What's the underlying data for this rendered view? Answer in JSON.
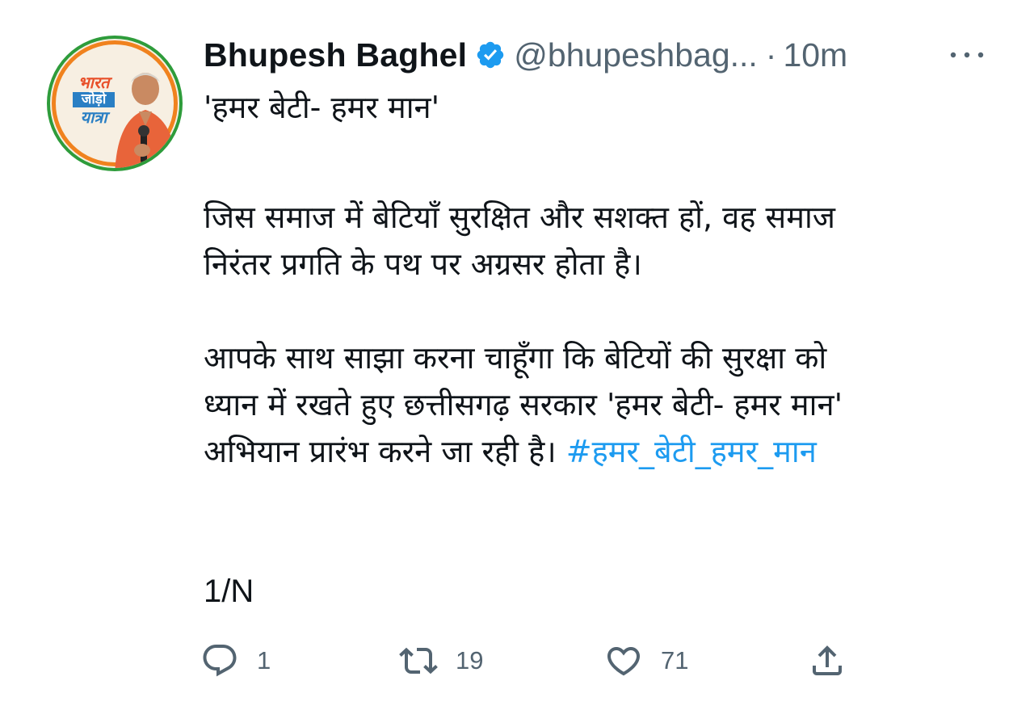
{
  "author": {
    "display_name": "Bhupesh Baghel",
    "handle": "@bhupeshbag...",
    "separator": "·",
    "timestamp": "10m",
    "verified": true,
    "avatar_logo": [
      "भारत",
      "जोड़ो",
      "यात्रा"
    ]
  },
  "tweet": {
    "title_line": "'हमर बेटी- हमर मान'",
    "paragraph1": [
      "जिस समाज में बेटियाँ सुरक्षित और सशक्त हों, वह समाज",
      "निरंतर प्रगति के पथ पर अग्रसर होता है।"
    ],
    "paragraph2": [
      "आपके साथ साझा करना चाहूँगा कि बेटियों की सुरक्षा को",
      "ध्यान में रखते हुए छत्तीसगढ़ सरकार 'हमर बेटी- हमर मान'"
    ],
    "paragraph2_last_text": "अभियान प्रारंभ करने जा रही है। ",
    "hashtag": "#हमर_बेटी_हमर_मान",
    "thread_marker": "1/N"
  },
  "actions": {
    "reply_count": "1",
    "retweet_count": "19",
    "like_count": "71"
  },
  "colors": {
    "text": "#0f1419",
    "secondary": "#536471",
    "link": "#1d9bf0",
    "verified": "#1d9bf0"
  },
  "icons": {
    "verified": "verified-badge-icon",
    "more": "more-horizontal-icon",
    "reply": "reply-bubble-icon",
    "retweet": "retweet-icon",
    "like": "heart-icon",
    "share": "share-upload-icon"
  }
}
